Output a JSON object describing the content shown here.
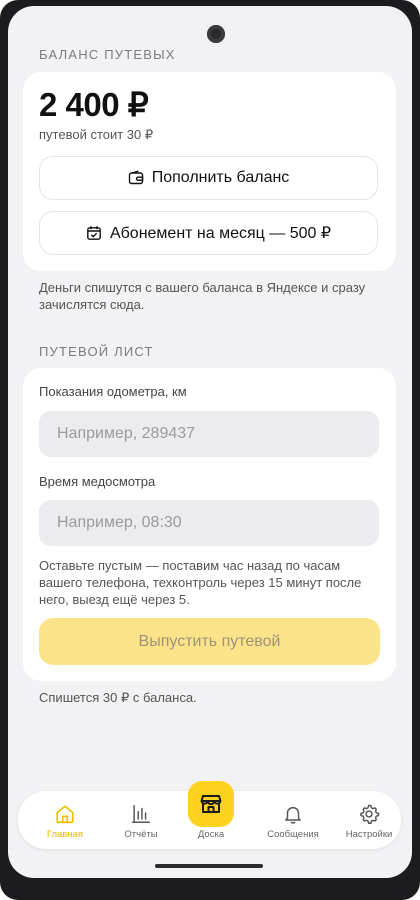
{
  "balance_section": {
    "title": "БАЛАНС ПУТЕВЫХ",
    "amount": "2 400 ₽",
    "price_note": "путевой стоит 30 ₽",
    "top_up_label": "Пополнить баланс",
    "subscription_label": "Абонемент на месяц — 500 ₽",
    "note": "Деньги спишутся с вашего баланса в Яндексе и сразу зачислятся сюда."
  },
  "waybill_section": {
    "title": "ПУТЕВОЙ ЛИСТ",
    "odometer_label": "Показания одометра, км",
    "odometer_placeholder": "Например, 289437",
    "medcheck_label": "Время медосмотра",
    "medcheck_placeholder": "Например, 08:30",
    "hint": "Оставьте пустым — поставим час назад по часам вашего телефона, техконтроль через 15 минут после него, выезд ещё через 5.",
    "issue_button_label": "Выпустить путевой",
    "charge_note": "Спишется 30 ₽ с баланса."
  },
  "bottom_nav": {
    "items": [
      {
        "label": "Главная",
        "icon": "home-icon",
        "active": true
      },
      {
        "label": "Отчёты",
        "icon": "chart-icon"
      },
      {
        "label": "Доска",
        "icon": "store-icon"
      },
      {
        "label": "Сообщения",
        "icon": "bell-icon"
      },
      {
        "label": "Настройки",
        "icon": "gear-icon"
      }
    ]
  },
  "colors": {
    "accent": "#ffd21f",
    "accent_disabled": "#fbe38a",
    "background": "#f2f2f4"
  }
}
